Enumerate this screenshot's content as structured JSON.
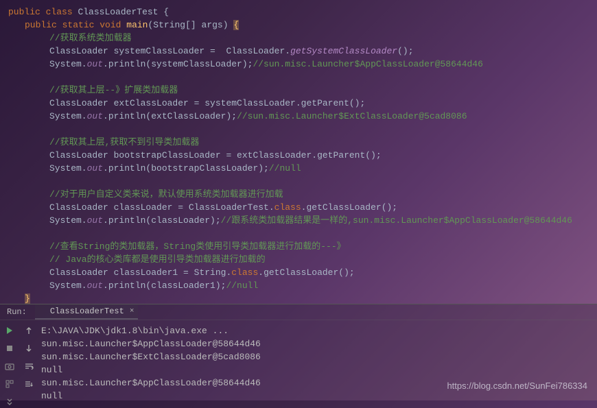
{
  "code": {
    "l1_public": "public",
    "l1_class": "class",
    "l1_name": "ClassLoaderTest",
    "l1_brace": " {",
    "l2_public": "public",
    "l2_static": "static",
    "l2_void": "void",
    "l2_main": "main",
    "l2_params": "(String[] args) ",
    "l2_brace": "{",
    "c1": "//获取系统类加载器",
    "l3a": "ClassLoader systemClassLoader =  ClassLoader.",
    "l3b": "getSystemClassLoader",
    "l3c": "();",
    "l4a": "System.",
    "l4b": "out",
    "l4c": ".println(systemClassLoader);",
    "l4d": "//sun.misc.Launcher$AppClassLoader@58644d46",
    "c2": "//获取其上层--》扩展类加载器",
    "l5": "ClassLoader extClassLoader = systemClassLoader.getParent();",
    "l6a": "System.",
    "l6b": "out",
    "l6c": ".println(extClassLoader);",
    "l6d": "//sun.misc.Launcher$ExtClassLoader@5cad8086",
    "c3": "//获取其上层,获取不到引导类加载器",
    "l7": "ClassLoader bootstrapClassLoader = extClassLoader.getParent();",
    "l8a": "System.",
    "l8b": "out",
    "l8c": ".println(bootstrapClassLoader);",
    "l8d": "//null",
    "c4": "//对于用户自定义类来说，默认使用系统类加载器进行加载",
    "l9a": "ClassLoader classLoader = ClassLoaderTest.",
    "l9b": "class",
    "l9c": ".getClassLoader();",
    "l10a": "System.",
    "l10b": "out",
    "l10c": ".println(classLoader);",
    "l10d": "//跟系统类加载器结果是一样的,sun.misc.Launcher$AppClassLoader@58644d46",
    "c5a": "//查看String的类加载器，String类使用引导类加载器进行加载的---》",
    "c5b": "// Java的核心类库都是使用引导类加载器进行加载的",
    "l11a": "ClassLoader classLoader1 = String.",
    "l11b": "class",
    "l11c": ".getClassLoader();",
    "l12a": "System.",
    "l12b": "out",
    "l12c": ".println(classLoader1);",
    "l12d": "//null",
    "close_brace": "}"
  },
  "run": {
    "label": "Run:",
    "tab_name": "ClassLoaderTest",
    "output": [
      "E:\\JAVA\\JDK\\jdk1.8\\bin\\java.exe ...",
      "sun.misc.Launcher$AppClassLoader@58644d46",
      "sun.misc.Launcher$ExtClassLoader@5cad8086",
      "null",
      "sun.misc.Launcher$AppClassLoader@58644d46",
      "null"
    ]
  },
  "watermark": "https://blog.csdn.net/SunFei786334"
}
